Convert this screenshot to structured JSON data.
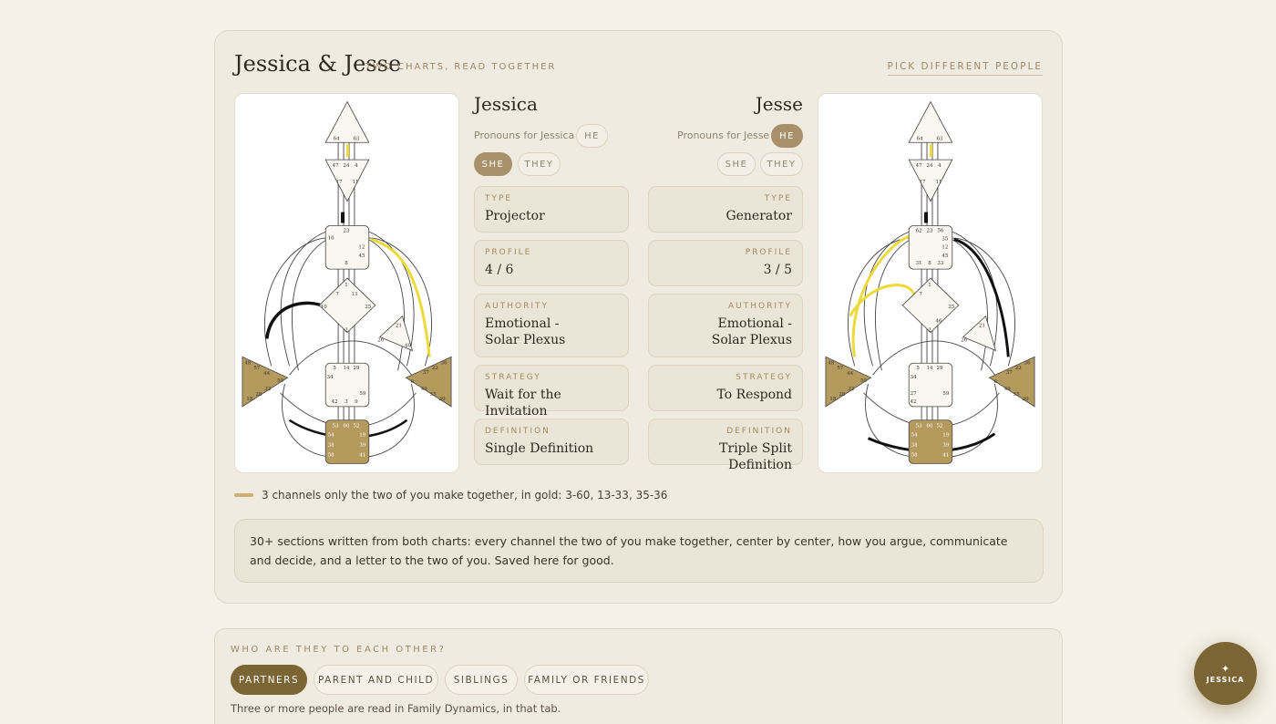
{
  "header": {
    "title": "Jessica & Jesse",
    "subtitle": "Two charts, read together",
    "pick_link": "Pick different people"
  },
  "person_left": {
    "name": "Jessica",
    "pronoun_label": "Pronouns for Jessica",
    "pronouns": [
      "He",
      "She",
      "They"
    ],
    "selected_pronoun": "She",
    "fields": [
      {
        "label": "Type",
        "value": "Projector"
      },
      {
        "label": "Profile",
        "value": "4 / 6"
      },
      {
        "label": "Authority",
        "value": "Emotional -\nSolar Plexus"
      },
      {
        "label": "Strategy",
        "value": "Wait for the Invitation"
      },
      {
        "label": "Definition",
        "value": "Single Definition"
      }
    ]
  },
  "person_right": {
    "name": "Jesse",
    "pronoun_label": "Pronouns for Jesse",
    "pronouns": [
      "He",
      "She",
      "They"
    ],
    "selected_pronoun": "He",
    "fields": [
      {
        "label": "Type",
        "value": "Generator"
      },
      {
        "label": "Profile",
        "value": "3 / 5"
      },
      {
        "label": "Authority",
        "value": "Emotional -\nSolar Plexus"
      },
      {
        "label": "Strategy",
        "value": "To Respond"
      },
      {
        "label": "Definition",
        "value": "Triple Split Definition"
      }
    ]
  },
  "left_chart_gates": {
    "head": [
      "64",
      "63"
    ],
    "ajna": [
      "47",
      "24",
      "4",
      "17",
      "11"
    ],
    "throat": [
      "23",
      "16",
      "12",
      "45",
      "8"
    ],
    "g": [
      "1",
      "7",
      "13",
      "10",
      "25",
      "2"
    ],
    "heart": [
      "21",
      "26",
      "40"
    ],
    "spleen": [
      "48",
      "57",
      "44",
      "50",
      "32",
      "28",
      "18"
    ],
    "sacral": [
      "5",
      "14",
      "29",
      "34",
      "59",
      "42",
      "3",
      "9"
    ],
    "solar": [
      "36",
      "22",
      "37",
      "6",
      "49",
      "55",
      "30"
    ],
    "root": [
      "53",
      "60",
      "52",
      "54",
      "19",
      "38",
      "39",
      "58",
      "41"
    ]
  },
  "right_chart_gates": {
    "head": [
      "64",
      "63"
    ],
    "ajna": [
      "47",
      "24",
      "4",
      "17",
      "11"
    ],
    "throat": [
      "62",
      "23",
      "56",
      "35",
      "12",
      "45",
      "31",
      "8",
      "33"
    ],
    "g": [
      "1",
      "7",
      "25",
      "46",
      "2"
    ],
    "heart": [
      "21",
      "26"
    ],
    "spleen": [
      "48",
      "57",
      "44",
      "50",
      "32",
      "28",
      "18"
    ],
    "sacral": [
      "5",
      "14",
      "29",
      "34",
      "27",
      "59",
      "42"
    ],
    "solar": [
      "36",
      "22",
      "37",
      "6",
      "49",
      "55",
      "30"
    ],
    "root": [
      "53",
      "60",
      "52",
      "54",
      "19",
      "38",
      "39",
      "58",
      "41"
    ]
  },
  "gold_note": "3 channels only the two of you make together, in gold: 3-60, 13-33, 35-36",
  "summary": "30+ sections written from both charts: every channel the two of you make together, center by center, how you argue, communicate and decide, and a letter to the two of you. Saved here for good.",
  "relationship": {
    "question": "Who are they to each other?",
    "options": [
      "Partners",
      "Parent and child",
      "Siblings",
      "Family or friends"
    ],
    "selected": "Partners",
    "note": "Three or more people are read in Family Dynamics, in that tab."
  },
  "fab": {
    "star": "✦",
    "label": "JESSICA"
  },
  "colors": {
    "accent": "#7c6535",
    "gold": "#cfae72",
    "center_fill": "#b59a5e",
    "yellow": "#ecd93a"
  }
}
